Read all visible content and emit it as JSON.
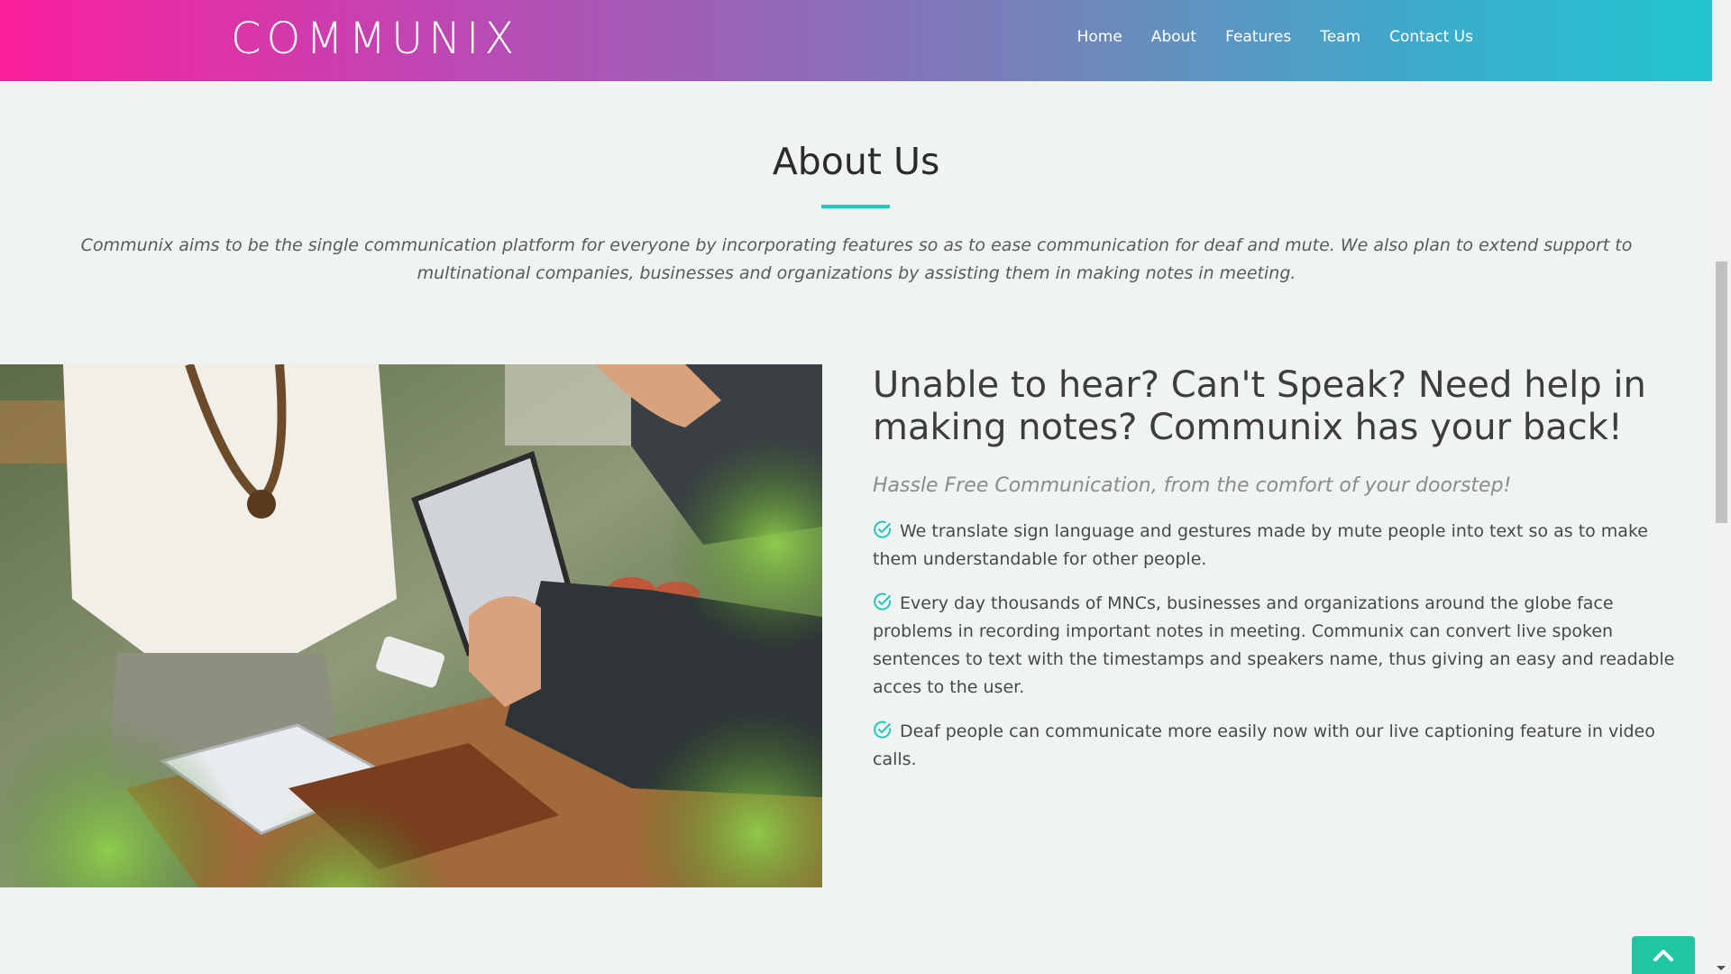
{
  "brand": {
    "name": "COMMUNIX"
  },
  "nav": {
    "items": [
      {
        "label": "Home"
      },
      {
        "label": "About"
      },
      {
        "label": "Features"
      },
      {
        "label": "Team"
      },
      {
        "label": "Contact Us"
      }
    ]
  },
  "about": {
    "title": "About Us",
    "intro": "Communix aims to be the single communication platform for everyone by incorporating features so as to ease communication for deaf and mute. We also plan to extend support to multinational companies, businesses and organizations by assisting them in making notes in meeting."
  },
  "content": {
    "headline": "Unable to hear? Can't Speak? Need help in making notes? Communix has your back!",
    "tagline": "Hassle Free Communication, from the comfort of your doorstep!",
    "features": [
      {
        "text": "We translate sign language and gestures made by mute people into text so as to make them understandable for other people."
      },
      {
        "text": "Every day thousands of MNCs, businesses and organizations around the globe face problems in recording important notes in meeting. Communix can convert live spoken sentences to text with the timestamps and speakers name, thus giving an easy and readable acces to the user."
      },
      {
        "text": "Deaf people can communicate more easily now with our live captioning feature in video calls."
      }
    ],
    "check_icon": "check-circle-icon"
  },
  "colors": {
    "accent": "#24c6b6",
    "gradient_start": "#fc1f9d",
    "gradient_end": "#22c6d0",
    "back_to_top": "#1fc6a3"
  },
  "icons": {
    "back_to_top": "chevron-up-icon"
  }
}
